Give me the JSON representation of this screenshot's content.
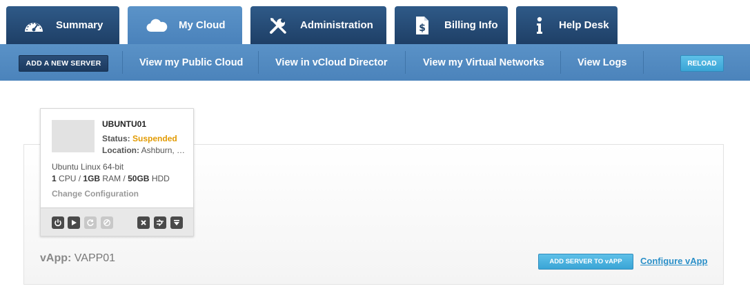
{
  "tabs": [
    {
      "label": "Summary",
      "icon": "speedometer-icon",
      "active": false
    },
    {
      "label": "My Cloud",
      "icon": "cloud-icon",
      "active": true
    },
    {
      "label": "Administration",
      "icon": "wrench-screwdriver-icon",
      "active": false
    },
    {
      "label": "Billing Info",
      "icon": "invoice-dollar-icon",
      "active": false
    },
    {
      "label": "Help Desk",
      "icon": "info-icon",
      "active": false
    }
  ],
  "subnav": {
    "add_server": "ADD A NEW SERVER",
    "links": [
      "View my Public Cloud",
      "View in vCloud Director",
      "View my Virtual Networks",
      "View Logs"
    ],
    "reload": "RELOAD"
  },
  "server": {
    "name": "UBUNTU01",
    "status_label": "Status:",
    "status_value": "Suspended",
    "location_label": "Location:",
    "location_value": "Ashburn, …",
    "os": "Ubuntu Linux 64-bit",
    "cpu": "1",
    "cpu_unit": "CPU /",
    "ram": "1GB",
    "ram_unit": "RAM /",
    "hdd": "50GB",
    "hdd_unit": "HDD",
    "change_config": "Change Configuration"
  },
  "vapp": {
    "label": "vApp:",
    "name": "VAPP01",
    "add_button": "ADD SERVER TO vAPP",
    "configure_link": "Configure vApp"
  },
  "colors": {
    "tab_dark": "#264c77",
    "tab_active": "#5590c6",
    "subnav": "#5089c1",
    "status_suspended": "#e29a00",
    "accent_button": "#46afdd",
    "link": "#2a8fc8"
  }
}
